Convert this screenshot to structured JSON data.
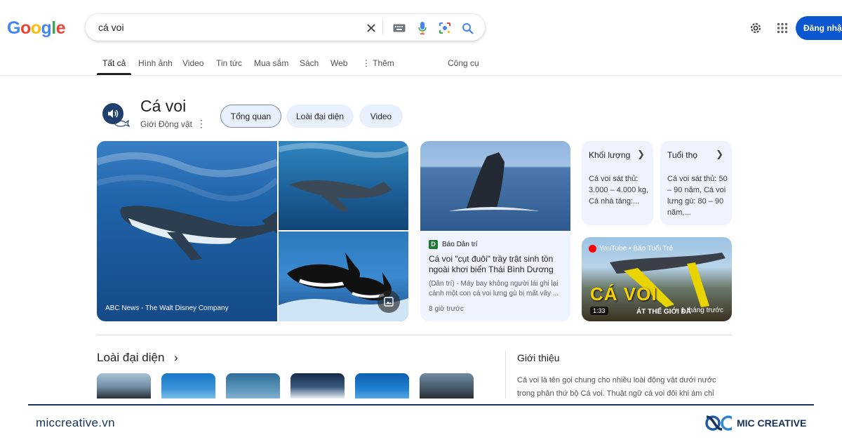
{
  "header": {
    "logo_text": "Google",
    "search_query": "cá voi",
    "login_label": "Đăng nhập"
  },
  "tabs": [
    {
      "label": "Tất cả",
      "active": true
    },
    {
      "label": "Hình ảnh"
    },
    {
      "label": "Video"
    },
    {
      "label": "Tin tức"
    },
    {
      "label": "Mua sắm"
    },
    {
      "label": "Sách"
    },
    {
      "label": "Web"
    },
    {
      "label": "Thêm"
    },
    {
      "label": "Công cụ"
    }
  ],
  "entity": {
    "title": "Cá voi",
    "subtitle": "Giới Động vật",
    "chips": [
      "Tổng quan",
      "Loài đại diện",
      "Video"
    ]
  },
  "images": {
    "main_caption": "ABC News - The Walt Disney Company"
  },
  "news": {
    "source_letter": "D",
    "source": "Báo Dân trí",
    "title": "Cá voi \"cụt đuôi\" trầy trật sinh tồn ngoài khơi biển Thái Bình Dương",
    "snippet": "(Dân trí) - Máy bay không người lái ghi lại cảnh một con cá voi lưng gù bị mất vây ...",
    "time": "8 giờ trước"
  },
  "facts": [
    {
      "label": "Khối lượng",
      "value": "Cá voi sát thủ: 3.000 – 4.000 kg, Cá nhà táng:..."
    },
    {
      "label": "Tuổi thọ",
      "value": "Cá voi sát thủ: 50 – 90 năm, Cá voi lưng gù: 80 – 90 năm,..."
    }
  ],
  "video": {
    "source": "YouTube • Báo Tuổi Trẻ",
    "overlay_title": "CÁ VOI",
    "overlay_sub": "ÁT THẾ GIỚI DA",
    "duration": "1:33",
    "ago": "1 tháng trước"
  },
  "species": {
    "title": "Loài đại diện",
    "chevron": "›"
  },
  "intro": {
    "title": "Giới thiệu",
    "text": "Cá voi là tên gọi chung cho nhiều loài động vật dưới nước trong phân thứ bộ Cá voi. Thuật ngữ cá voi đôi khi ám chỉ"
  },
  "footer": {
    "site": "miccreative.vn",
    "brand": "MIC CREATIVE"
  },
  "colors": {
    "accent_blue": "#0b57d0",
    "chip_bg": "#e8f0fe",
    "footer_navy": "#15325a"
  }
}
